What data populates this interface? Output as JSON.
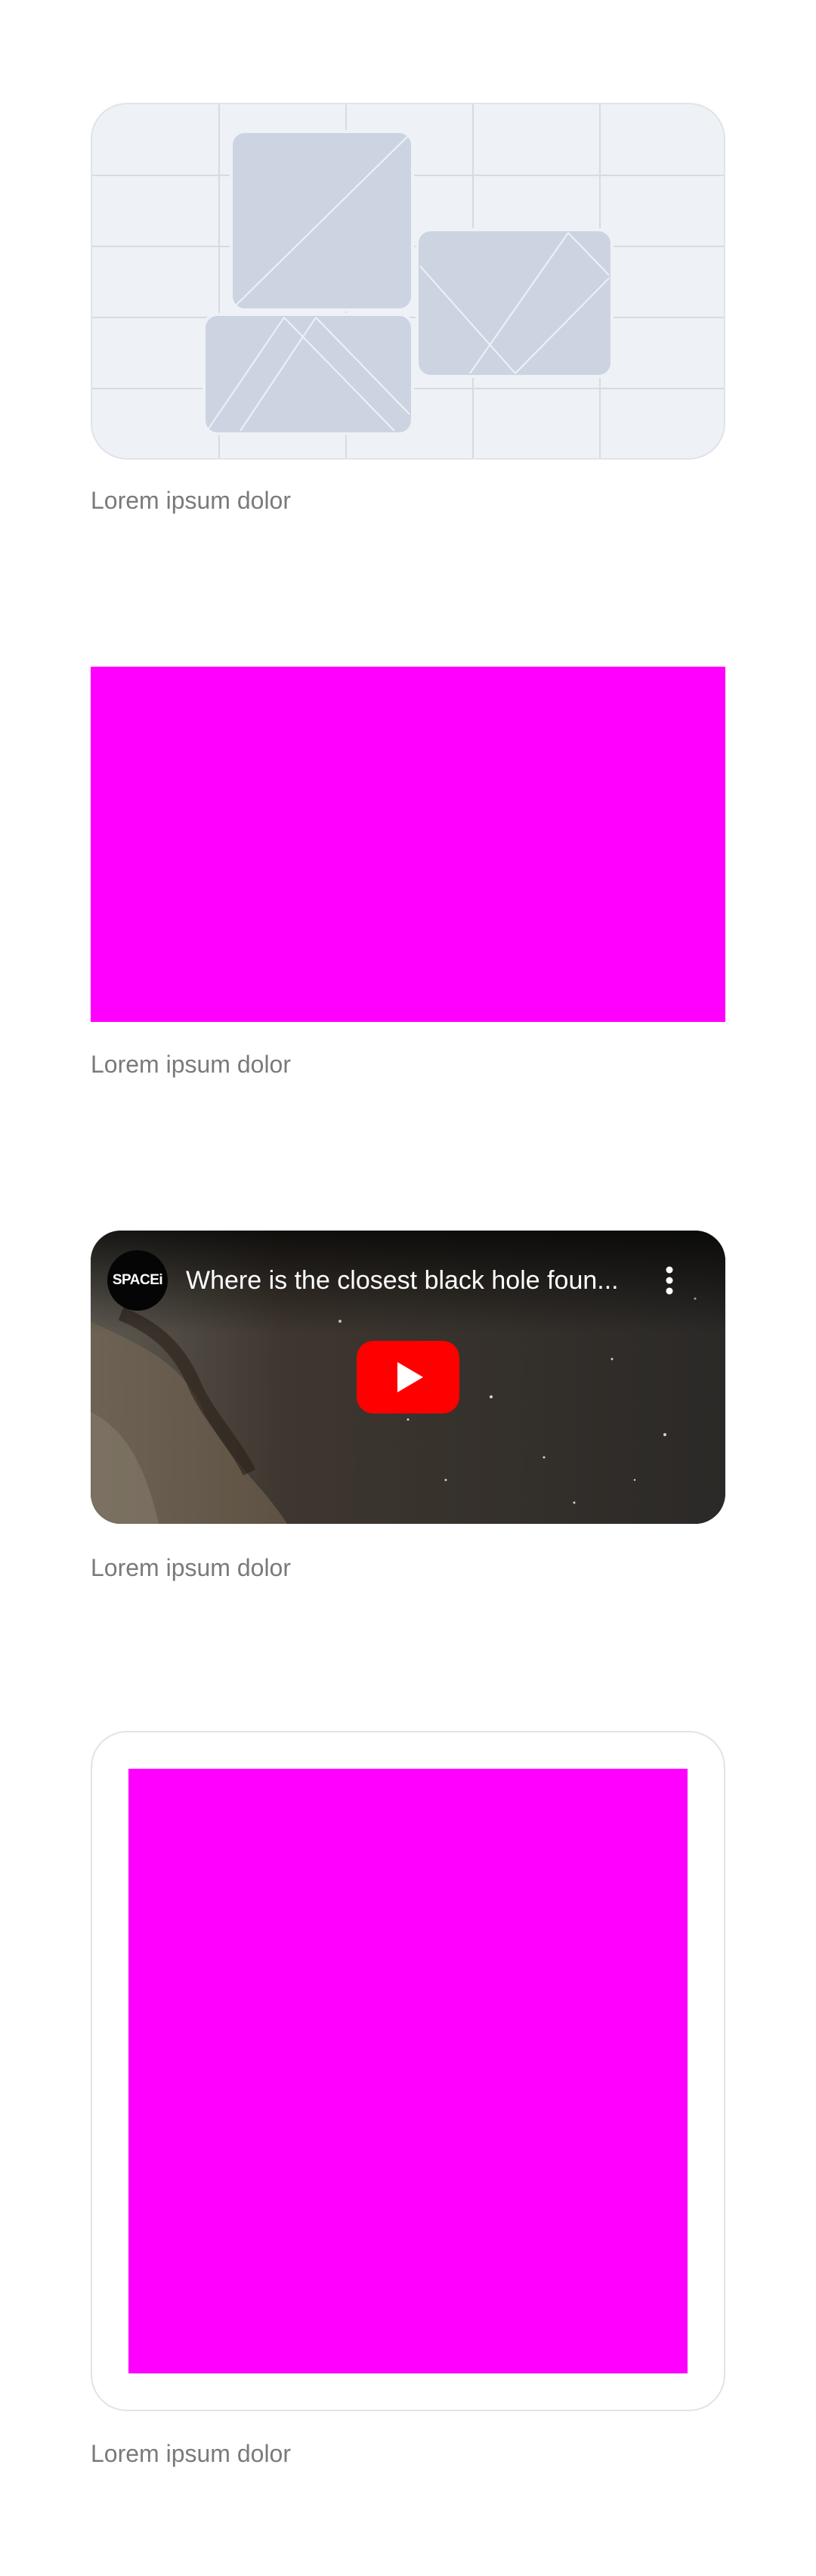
{
  "colors": {
    "magenta": "#ff00ff",
    "caption_text": "#7a7a7a",
    "placeholder_bg": "#eef1f6",
    "placeholder_shape": "#cdd4e1",
    "youtube_red": "#ff0000"
  },
  "sections": [
    {
      "type": "image-placeholder",
      "icon": "image-placeholder-icon",
      "caption": "Lorem ipsum dolor"
    },
    {
      "type": "color-block",
      "caption": "Lorem ipsum dolor"
    },
    {
      "type": "video-embed",
      "video": {
        "channel_logo_text": "SPACEi",
        "title": "Where is the closest black hole foun...",
        "more_icon": "more-vertical-icon",
        "play_icon": "youtube-play-icon"
      },
      "caption": "Lorem ipsum dolor"
    },
    {
      "type": "framed-color-block",
      "caption": "Lorem ipsum dolor"
    }
  ]
}
